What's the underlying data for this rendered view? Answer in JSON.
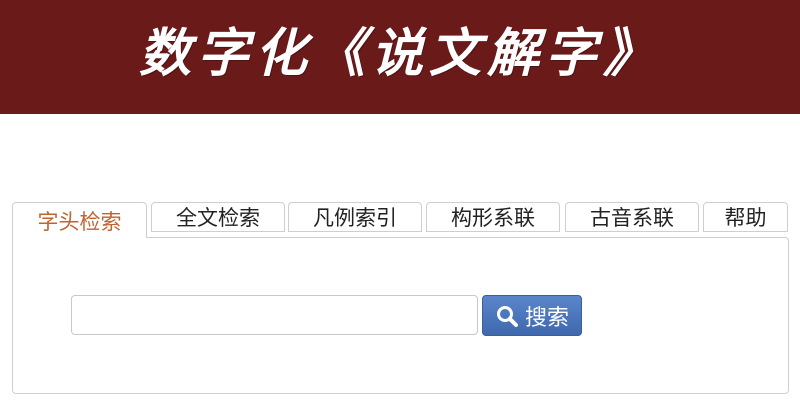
{
  "header": {
    "title": "数字化《说文解字》"
  },
  "tabs": [
    {
      "label": "字头检索",
      "active": true
    },
    {
      "label": "全文检索",
      "active": false
    },
    {
      "label": "凡例索引",
      "active": false
    },
    {
      "label": "构形系联",
      "active": false
    },
    {
      "label": "古音系联",
      "active": false
    },
    {
      "label": "帮助",
      "active": false
    }
  ],
  "search": {
    "value": "",
    "placeholder": "",
    "button_label": "搜索",
    "button_icon": "search-icon"
  },
  "colors": {
    "banner": "#6b1a1a",
    "active_tab_text": "#c2622d",
    "button": "#4a74bb"
  }
}
